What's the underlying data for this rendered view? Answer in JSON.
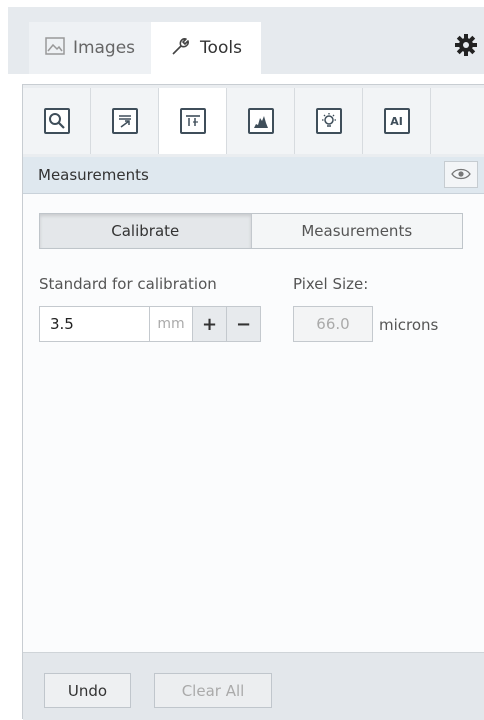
{
  "tabs": {
    "images_label": "Images",
    "tools_label": "Tools",
    "active": "Tools"
  },
  "toolbar": {
    "tools": [
      {
        "name": "zoom-search"
      },
      {
        "name": "annotate"
      },
      {
        "name": "measure",
        "active": true
      },
      {
        "name": "histogram"
      },
      {
        "name": "light"
      },
      {
        "name": "ai",
        "glyph": "AI"
      }
    ]
  },
  "section": {
    "title": "Measurements"
  },
  "mode": {
    "calibrate_label": "Calibrate",
    "measurements_label": "Measurements",
    "selected": "Calibrate"
  },
  "calibration": {
    "standard_label": "Standard for calibration",
    "standard_value": "3.5",
    "standard_unit": "mm",
    "plus": "+",
    "minus": "−",
    "pixel_size_label": "Pixel Size:",
    "pixel_size_value": "66.0",
    "pixel_size_unit": "microns"
  },
  "footer": {
    "undo_label": "Undo",
    "clear_all_label": "Clear All"
  },
  "colors": {
    "accent_icon": "#3f4e5a",
    "header_bg": "#dfe8ef"
  }
}
